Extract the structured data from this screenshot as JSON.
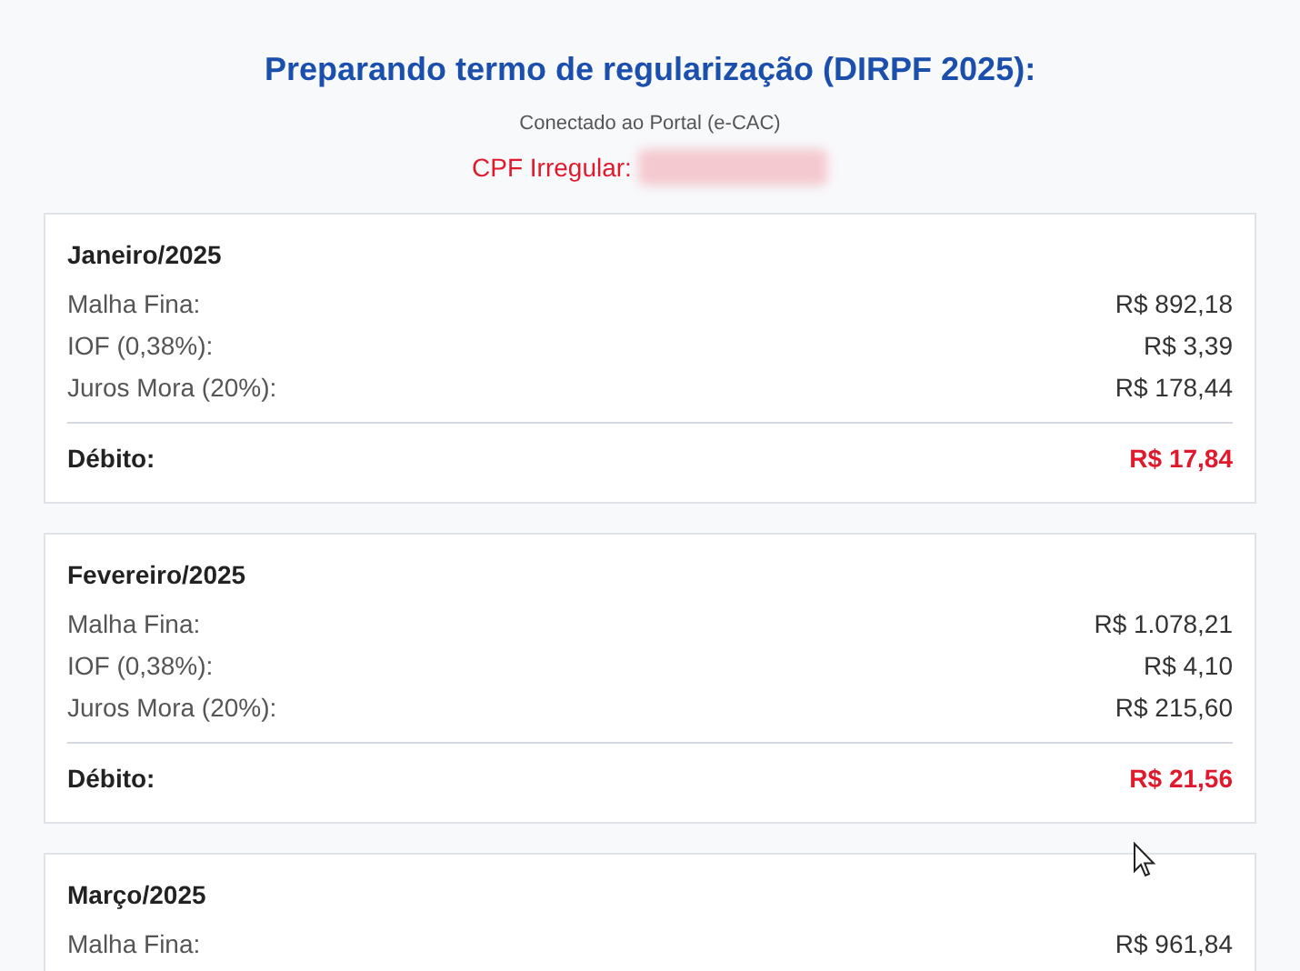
{
  "header": {
    "title": "Preparando termo de regularização (DIRPF 2025):",
    "subtitle": "Conectado ao Portal (e-CAC)",
    "cpf_label": "CPF Irregular:"
  },
  "months": [
    {
      "title": "Janeiro/2025",
      "rows": [
        {
          "label": "Malha Fina:",
          "value": "R$ 892,18"
        },
        {
          "label": "IOF (0,38%):",
          "value": "R$ 3,39"
        },
        {
          "label": "Juros Mora (20%):",
          "value": "R$ 178,44"
        }
      ],
      "debit": {
        "label": "Débito:",
        "value": "R$ 17,84"
      }
    },
    {
      "title": "Fevereiro/2025",
      "rows": [
        {
          "label": "Malha Fina:",
          "value": "R$ 1.078,21"
        },
        {
          "label": "IOF (0,38%):",
          "value": "R$ 4,10"
        },
        {
          "label": "Juros Mora (20%):",
          "value": "R$ 215,60"
        }
      ],
      "debit": {
        "label": "Débito:",
        "value": "R$ 21,56"
      }
    },
    {
      "title": "Março/2025",
      "rows": [
        {
          "label": "Malha Fina:",
          "value": "R$ 961,84"
        }
      ]
    }
  ]
}
